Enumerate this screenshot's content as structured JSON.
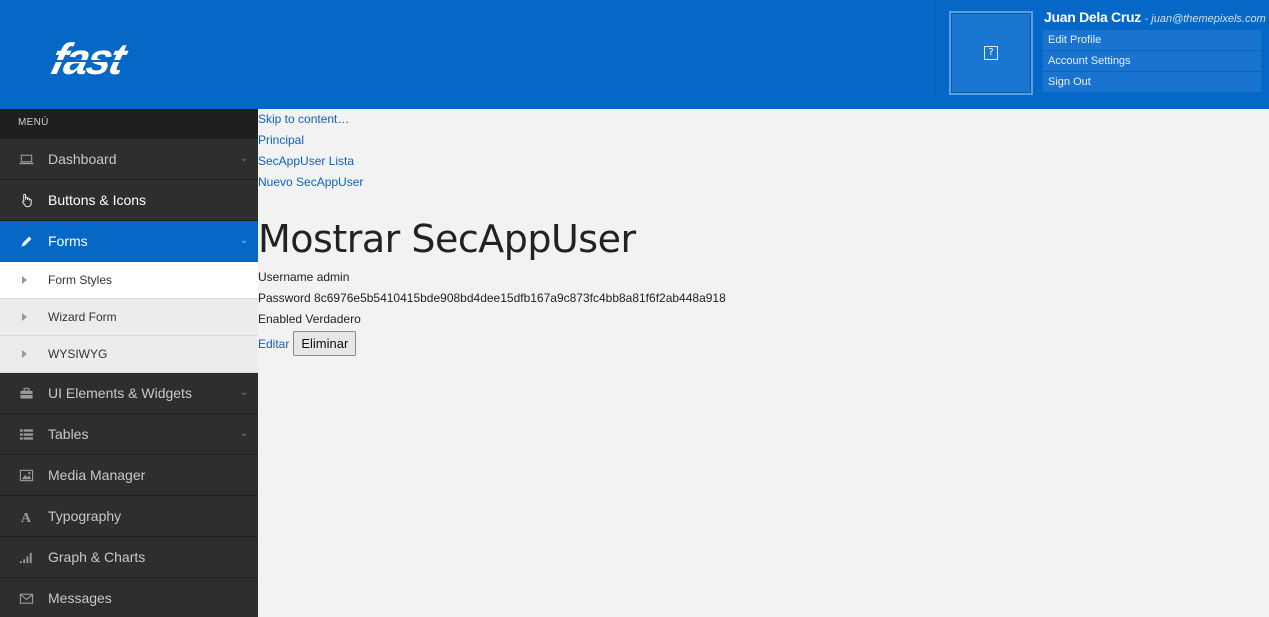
{
  "header": {
    "logo_text": "fast",
    "user": {
      "name": "Juan Dela Cruz",
      "email": "- juan@themepixels.com",
      "avatar_glyph": "?",
      "links": [
        "Edit Profile",
        "Account Settings",
        "Sign Out"
      ]
    }
  },
  "sidebar": {
    "heading": "MENÚ",
    "items": [
      {
        "label": "Dashboard",
        "icon": "laptop-icon"
      },
      {
        "label": "Buttons & Icons",
        "icon": "hand-pointer-icon"
      },
      {
        "label": "Forms",
        "icon": "pencil-icon",
        "active": true
      },
      {
        "label": "UI Elements & Widgets",
        "icon": "briefcase-icon"
      },
      {
        "label": "Tables",
        "icon": "list-icon"
      },
      {
        "label": "Media Manager",
        "icon": "image-icon"
      },
      {
        "label": "Typography",
        "icon": "font-icon"
      },
      {
        "label": "Graph & Charts",
        "icon": "signal-icon"
      },
      {
        "label": "Messages",
        "icon": "envelope-icon"
      }
    ],
    "submenu": [
      "Form Styles",
      "Wizard Form",
      "WYSIWYG"
    ]
  },
  "main": {
    "skip_link": "Skip to content…",
    "nav_links": [
      "Principal",
      "SecAppUser Lista",
      "Nuevo SecAppUser"
    ],
    "title": "Mostrar SecAppUser",
    "fields": [
      "Username admin",
      "Password 8c6976e5b5410415bde908bd4dee15dfb167a9c873fc4bb8a81f6f2ab448a918",
      "Enabled Verdadero"
    ],
    "edit_label": "Editar",
    "delete_label": "Eliminar"
  },
  "colors": {
    "brand_blue": "#0568c6",
    "sidebar_dark": "#2a2a2a",
    "link_blue": "#0b63bf"
  }
}
